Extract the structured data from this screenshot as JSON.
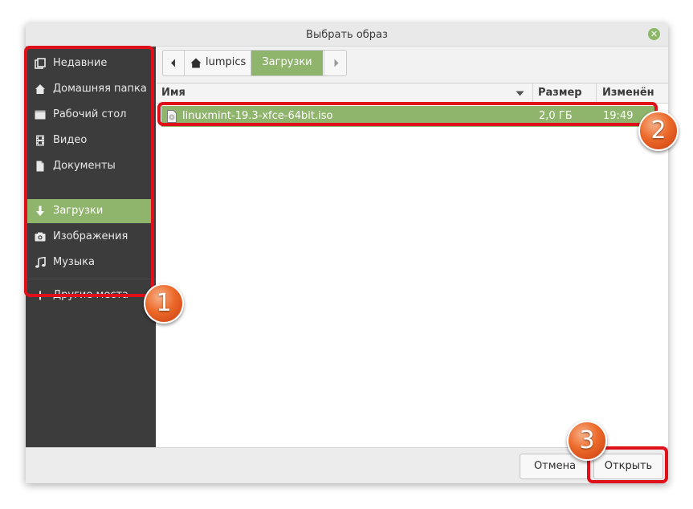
{
  "dialog": {
    "title": "Выбрать образ"
  },
  "sidebar": {
    "items": [
      {
        "label": "Недавние",
        "icon": "recent-icon"
      },
      {
        "label": "Домашняя папка",
        "icon": "home-icon"
      },
      {
        "label": "Рабочий стол",
        "icon": "desktop-icon"
      },
      {
        "label": "Видео",
        "icon": "film-icon"
      },
      {
        "label": "Документы",
        "icon": "document-icon"
      },
      {
        "label": "Загрузки",
        "icon": "download-icon",
        "active": true
      },
      {
        "label": "Изображения",
        "icon": "camera-icon"
      },
      {
        "label": "Музыка",
        "icon": "music-note-icon"
      },
      {
        "label": "Другие места",
        "icon": "plus-icon"
      }
    ]
  },
  "pathbar": {
    "home_label": "lumpics",
    "current_label": "Загрузки"
  },
  "columns": {
    "name": "Имя",
    "size": "Размер",
    "modified": "Изменён"
  },
  "files": [
    {
      "name": "linuxmint-19.3-xfce-64bit.iso",
      "size": "2,0 ГБ",
      "modified": "19:49",
      "selected": true
    }
  ],
  "buttons": {
    "cancel": "Отмена",
    "open": "Открыть"
  },
  "annotations": {
    "badge1": "1",
    "badge2": "2",
    "badge3": "3"
  },
  "colors": {
    "accent": "#8fb46b",
    "sidebar_bg": "#3c3c3c",
    "highlight": "#e0101a",
    "badge": "#ec6a2a"
  }
}
